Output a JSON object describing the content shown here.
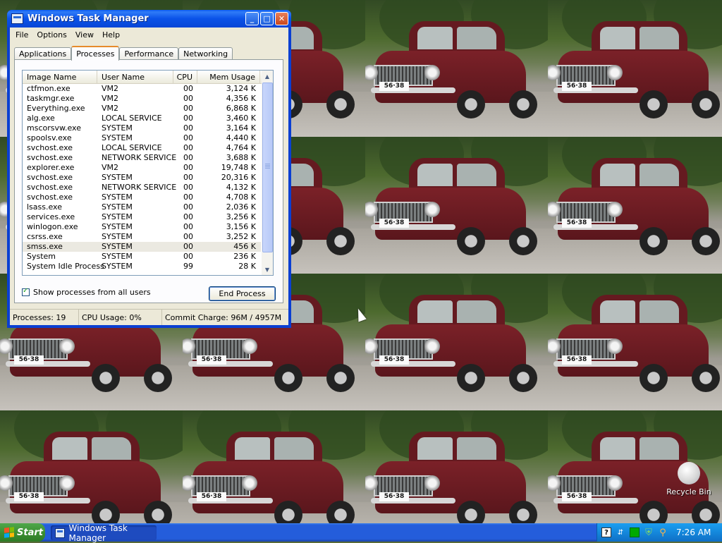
{
  "wallpaper": {
    "plate_text": "56·38",
    "tile_columns": 4,
    "tile_rows": 4
  },
  "window": {
    "title": "Windows Task Manager",
    "buttons": {
      "minimize": "_",
      "maximize": "□",
      "close": "✕"
    }
  },
  "menu": {
    "file": "File",
    "options": "Options",
    "view": "View",
    "help": "Help"
  },
  "tabs": {
    "applications": "Applications",
    "processes": "Processes",
    "performance": "Performance",
    "networking": "Networking"
  },
  "process_list": {
    "columns": {
      "image_name": "Image Name",
      "user_name": "User Name",
      "cpu": "CPU",
      "mem_usage": "Mem Usage"
    },
    "rows": [
      {
        "name": "ctfmon.exe",
        "user": "VM2",
        "cpu": "00",
        "mem": "3,124 K"
      },
      {
        "name": "taskmgr.exe",
        "user": "VM2",
        "cpu": "00",
        "mem": "4,356 K"
      },
      {
        "name": "Everything.exe",
        "user": "VM2",
        "cpu": "00",
        "mem": "6,868 K"
      },
      {
        "name": "alg.exe",
        "user": "LOCAL SERVICE",
        "cpu": "00",
        "mem": "3,460 K"
      },
      {
        "name": "mscorsvw.exe",
        "user": "SYSTEM",
        "cpu": "00",
        "mem": "3,164 K"
      },
      {
        "name": "spoolsv.exe",
        "user": "SYSTEM",
        "cpu": "00",
        "mem": "4,440 K"
      },
      {
        "name": "svchost.exe",
        "user": "LOCAL SERVICE",
        "cpu": "00",
        "mem": "4,764 K"
      },
      {
        "name": "svchost.exe",
        "user": "NETWORK SERVICE",
        "cpu": "00",
        "mem": "3,688 K"
      },
      {
        "name": "explorer.exe",
        "user": "VM2",
        "cpu": "00",
        "mem": "19,748 K"
      },
      {
        "name": "svchost.exe",
        "user": "SYSTEM",
        "cpu": "00",
        "mem": "20,316 K"
      },
      {
        "name": "svchost.exe",
        "user": "NETWORK SERVICE",
        "cpu": "00",
        "mem": "4,132 K"
      },
      {
        "name": "svchost.exe",
        "user": "SYSTEM",
        "cpu": "00",
        "mem": "4,708 K"
      },
      {
        "name": "lsass.exe",
        "user": "SYSTEM",
        "cpu": "00",
        "mem": "2,036 K"
      },
      {
        "name": "services.exe",
        "user": "SYSTEM",
        "cpu": "00",
        "mem": "3,256 K"
      },
      {
        "name": "winlogon.exe",
        "user": "SYSTEM",
        "cpu": "00",
        "mem": "3,156 K"
      },
      {
        "name": "csrss.exe",
        "user": "SYSTEM",
        "cpu": "00",
        "mem": "3,252 K"
      },
      {
        "name": "smss.exe",
        "user": "SYSTEM",
        "cpu": "00",
        "mem": "456 K",
        "selected": true
      },
      {
        "name": "System",
        "user": "SYSTEM",
        "cpu": "00",
        "mem": "236 K"
      },
      {
        "name": "System Idle Process",
        "user": "SYSTEM",
        "cpu": "99",
        "mem": "28 K"
      }
    ]
  },
  "options": {
    "show_all_label": "Show processes from all users",
    "show_all_checked": true
  },
  "end_process_label": "End Process",
  "status": {
    "processes": "Processes: 19",
    "cpu_usage": "CPU Usage: 0%",
    "commit_charge": "Commit Charge: 96M / 4957M"
  },
  "taskbar": {
    "start_label": "Start",
    "active_window": "Windows Task Manager",
    "clock": "7:26 AM"
  },
  "tray_icons": [
    "help-icon",
    "network-icon",
    "cpu-meter-icon",
    "shield-icon",
    "search-icon"
  ],
  "desktop": {
    "recycle_bin_label": "Recycle Bin"
  },
  "colors": {
    "title_bar": "#0a52e8",
    "taskbar": "#245ddb",
    "start_button": "#3c8f33",
    "window_face": "#ece9d8",
    "tab_highlight": "#e68b2c"
  }
}
